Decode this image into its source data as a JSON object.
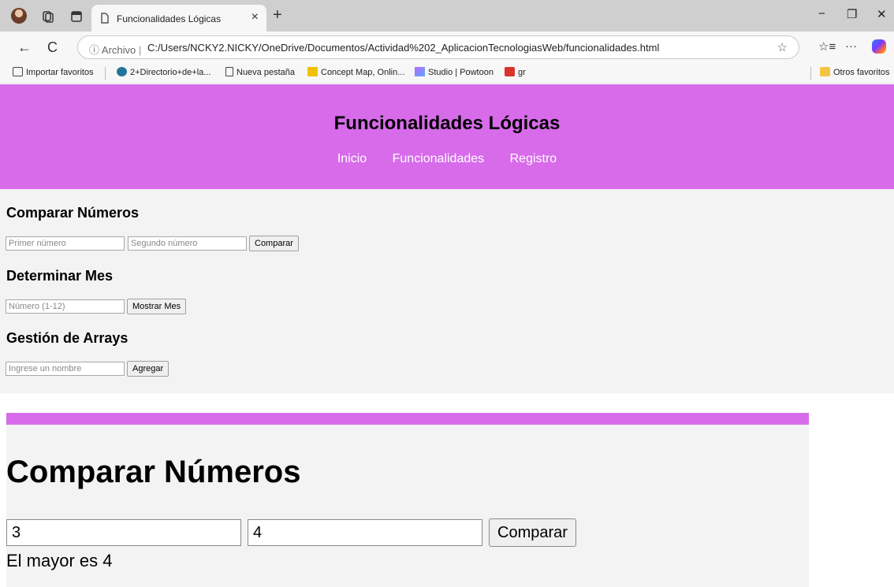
{
  "browser": {
    "tab_title": "Funcionalidades Lógicas",
    "tab_close": "×",
    "new_tab": "+",
    "url_prefix": "Archivo",
    "url": "C:/Users/NCKY2.NICKY/OneDrive/Documentos/Actividad%202_AplicacionTecnologiasWeb/funcionalidades.html",
    "bookmarks": [
      "Importar favoritos",
      "2+Directorio+de+la...",
      "Nueva pestaña",
      "Concept Map, Onlin...",
      "Studio | Powtoon",
      "gr"
    ],
    "other_favorites": "Otros favoritos",
    "icons": {
      "back": "←",
      "refresh": "C",
      "info": "ⓘ",
      "star": "☆",
      "favorites": "☆≡",
      "more": "···",
      "minimize": "−",
      "restore": "❐",
      "close": "✕"
    }
  },
  "page": {
    "title": "Funcionalidades Lógicas",
    "nav": [
      "Inicio",
      "Funcionalidades",
      "Registro"
    ],
    "sections": {
      "compare": {
        "heading": "Comparar Números",
        "placeholder_1": "Primer número",
        "placeholder_2": "Segundo número",
        "button": "Comparar"
      },
      "month": {
        "heading": "Determinar Mes",
        "placeholder": "Número (1-12)",
        "button": "Mostrar Mes"
      },
      "arrays": {
        "heading": "Gestión de Arrays",
        "placeholder": "Ingrese un nombre",
        "button": "Agregar"
      }
    },
    "big_compare": {
      "heading": "Comparar Números",
      "value_1": "3",
      "value_2": "4",
      "button": "Comparar",
      "result": "El mayor es 4"
    }
  },
  "colors": {
    "header": "#d76bea",
    "content_bg": "#f3f3f3"
  }
}
